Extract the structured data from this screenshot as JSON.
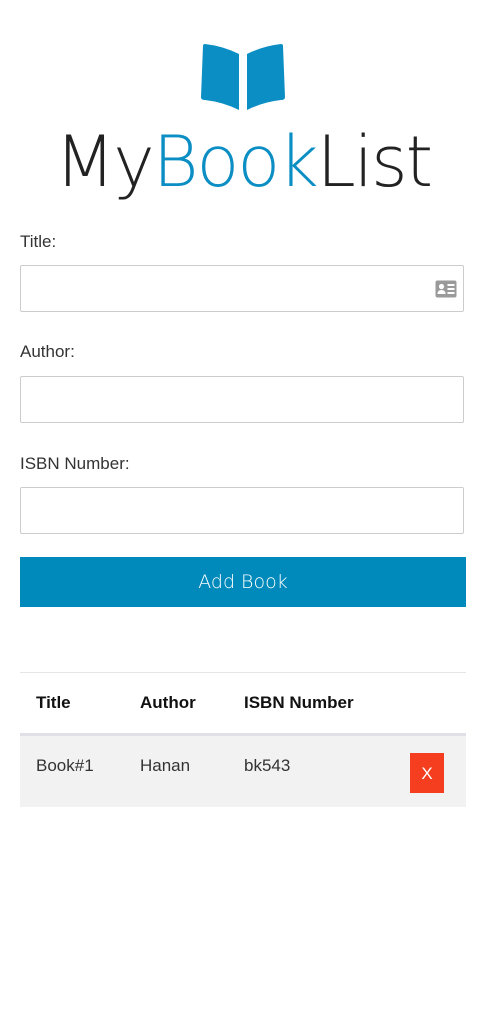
{
  "header": {
    "logo_icon": "open-book-icon",
    "brand_part1": "My",
    "brand_part2": "Book",
    "brand_part3": "List",
    "accent_color": "#0b8ec4"
  },
  "form": {
    "title_label": "Title:",
    "title_value": "",
    "title_trailing_icon": "contact-card-icon",
    "author_label": "Author:",
    "author_value": "",
    "isbn_label": "ISBN Number:",
    "isbn_value": "",
    "submit_label": "Add Book",
    "submit_color": "#008abb"
  },
  "table": {
    "columns": [
      "Title",
      "Author",
      "ISBN Number",
      ""
    ],
    "rows": [
      {
        "title": "Book#1",
        "author": "Hanan",
        "isbn": "bk543",
        "delete_label": "X"
      }
    ],
    "delete_color": "#f43e1f"
  }
}
